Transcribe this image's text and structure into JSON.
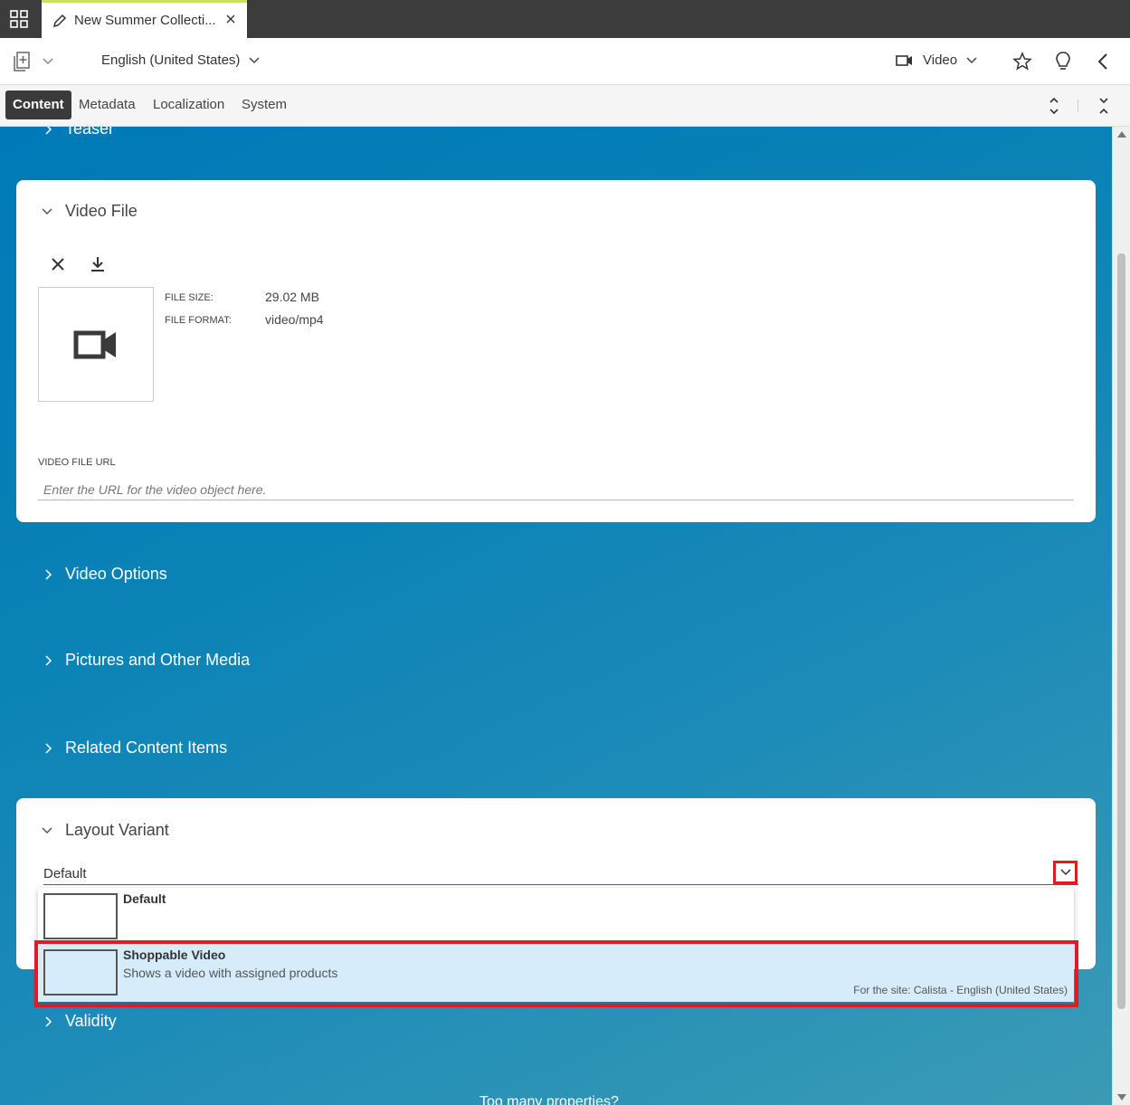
{
  "tabbar": {
    "apps_icon": "grid-icon",
    "tab_title": "New Summer Collecti...",
    "tab_icon": "pencil-icon",
    "close_icon": "close-icon"
  },
  "toolbar": {
    "language": "English (United States)",
    "doc_type": "Video"
  },
  "subtabs": [
    "Content",
    "Metadata",
    "Localization",
    "System"
  ],
  "sections": {
    "teaser": "Teaser",
    "video_file": {
      "title": "Video File",
      "file_size_label": "FILE SIZE:",
      "file_size": "29.02 MB",
      "file_format_label": "FILE FORMAT:",
      "file_format": "video/mp4",
      "url_label": "VIDEO FILE URL",
      "url_placeholder": "Enter the URL for the video object here."
    },
    "video_options": "Video Options",
    "pictures": "Pictures and Other Media",
    "related": "Related Content Items",
    "layout_variant": {
      "title": "Layout Variant",
      "selected": "Default",
      "options": [
        {
          "title": "Default",
          "description": "",
          "site": ""
        },
        {
          "title": "Shoppable Video",
          "description": "Shows a video with assigned products",
          "site": "For the site: Calista - English (United States)"
        }
      ]
    },
    "validity": "Validity",
    "bottom_text": "Too many properties?"
  },
  "colors": {
    "accent_red": "#e01b24",
    "highlight_bg": "#d6ecfb",
    "content_bg": "#0a82b6"
  }
}
